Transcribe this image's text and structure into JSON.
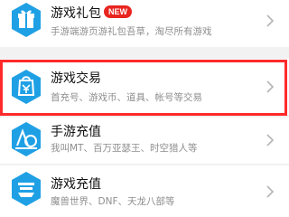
{
  "items": [
    {
      "title": "游戏礼包",
      "badge": "NEW",
      "subtitle": "手游端游页游礼包吾草，淘尽所有游戏",
      "icon": "gift-icon"
    },
    {
      "title": "游戏交易",
      "subtitle": "首充号、游戏币、道具、帐号等交易",
      "icon": "trade-bag-icon"
    },
    {
      "title": "手游充值",
      "subtitle": "我叫MT、百万亚瑟王、时空猎人等",
      "icon": "mobile-recharge-icon"
    },
    {
      "title": "游戏充值",
      "subtitle": "魔兽世界、DNF、天龙八部等",
      "icon": "game-recharge-icon"
    }
  ],
  "colors": {
    "accent": "#1fa0e5",
    "highlight": "#ff2a2a",
    "badge": "#e8251f"
  }
}
